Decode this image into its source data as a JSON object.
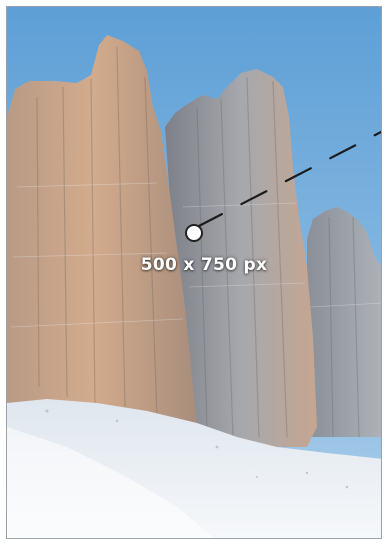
{
  "image": {
    "size_label": "500 x 750 px"
  },
  "colors": {
    "sky_top": "#5d9fd6",
    "sky_bottom": "#a9cdea",
    "rock_warm": "#c9a487",
    "rock_cool": "#8e9196",
    "snow": "#eef2f6",
    "guide_line": "#1c1c1c"
  },
  "icons": {
    "drag_handle": "circle-handle-icon"
  }
}
